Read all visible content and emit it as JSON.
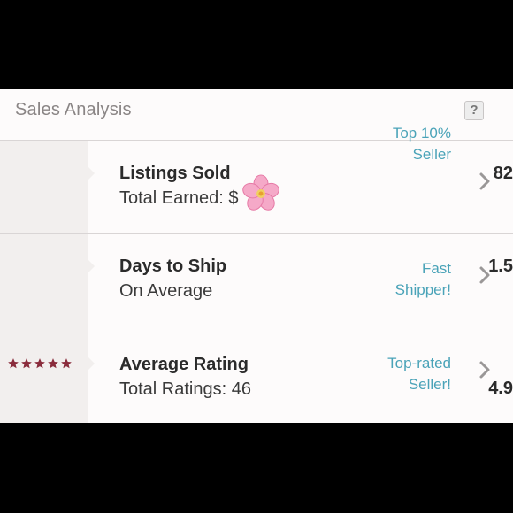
{
  "header": {
    "title": "Sales Analysis",
    "help_label": "?"
  },
  "rows": [
    {
      "stat": "82",
      "title": "Listings Sold",
      "subtitle": "Total Earned: $",
      "badge_line1": "Top 10%",
      "badge_line2": "Seller"
    },
    {
      "stat": "1.5",
      "title": "Days to Ship",
      "subtitle": "On Average",
      "badge_line1": "Fast",
      "badge_line2": "Shipper!"
    },
    {
      "stat": "4.9",
      "stars": 5,
      "title": "Average Rating",
      "subtitle": "Total Ratings: 46",
      "badge_line1": "Top-rated",
      "badge_line2": "Seller!"
    }
  ],
  "icons": {
    "help": "question-mark-icon",
    "chevron": "chevron-right-icon",
    "star": "star-icon",
    "flower": "cherry-blossom-icon"
  },
  "colors": {
    "badge_text": "#4aa3b8",
    "star": "#8a2c3c",
    "stat_column": "#f2efee",
    "background": "#fdfbfb",
    "frame": "#000000"
  }
}
